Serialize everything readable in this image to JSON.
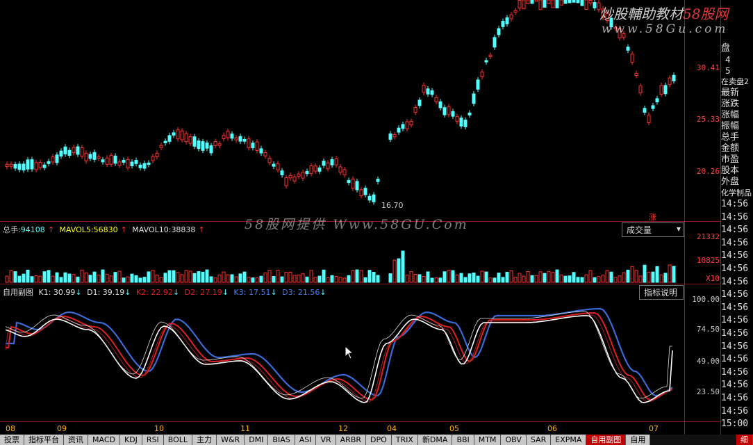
{
  "watermark": {
    "top_line1": "炒股輔助教材",
    "top_line1_brand": "58股网",
    "top_line2": "www.58Gu.com",
    "center": "58股网提供 Www.58GU.Com"
  },
  "main_panel": {
    "price_labels": [
      "30.41",
      "25.33",
      "20.26"
    ],
    "low_marker": "16.70"
  },
  "volume_panel": {
    "info": {
      "label": "总手:",
      "value": "94108",
      "mavol5_label": "MAVOL5:",
      "mavol5": "56830",
      "mavol10_label": "MAVOL10:",
      "mavol10": "38838"
    },
    "labels": [
      "21332",
      "10825",
      "X10"
    ],
    "button": "成交量",
    "rise_badge": "涨"
  },
  "kdj_panel": {
    "info": {
      "name": "自用副图",
      "k1": "K1: 30.99",
      "d1": "D1: 39.19",
      "k2": "K2: 22.92",
      "d2": "D2: 27.19",
      "k3": "K3: 17.51",
      "d3": "D3: 21.56"
    },
    "labels": [
      "100.00",
      "74.50",
      "49.00",
      "23.50"
    ],
    "button": "指标说明"
  },
  "x_axis": [
    "08",
    "09",
    "10",
    "11",
    "12",
    "04",
    "05",
    "06",
    "07"
  ],
  "side_panel": {
    "top": [
      "盘",
      "4",
      "5"
    ],
    "title": "在卖盘2",
    "items": [
      "最新",
      "涨跌",
      "涨幅",
      "振幅",
      "总手",
      "金额",
      "市盈",
      "股本",
      "外盘"
    ],
    "sector": "化学制品",
    "times": [
      "14:56",
      "14:56",
      "14:56",
      "14:56",
      "14:56",
      "14:56",
      "14:56",
      "14:56",
      "14:56",
      "14:56",
      "14:56",
      "14:56",
      "14:56",
      "14:56",
      "14:56",
      "14:56",
      "14:56",
      "15:00"
    ]
  },
  "tabs": [
    "投票",
    "指标平台",
    "资讯",
    "MACD",
    "KDJ",
    "RSI",
    "BOLL",
    "主力",
    "W&R",
    "DMI",
    "BIAS",
    "ASI",
    "VR",
    "ARBR",
    "DPO",
    "TRIX",
    "新DMA",
    "BBI",
    "MTM",
    "OBV",
    "SAR",
    "EXPMA",
    "自用副图",
    "自用"
  ],
  "active_tab": "自用副图",
  "bottom_right": "细",
  "colors": {
    "up": "#ff3030",
    "down": "#54ffff",
    "grid": "#8b1a1a",
    "k_line": "#ffffff",
    "d_line": "#e02020",
    "j_line": "#3a6bd8"
  }
}
